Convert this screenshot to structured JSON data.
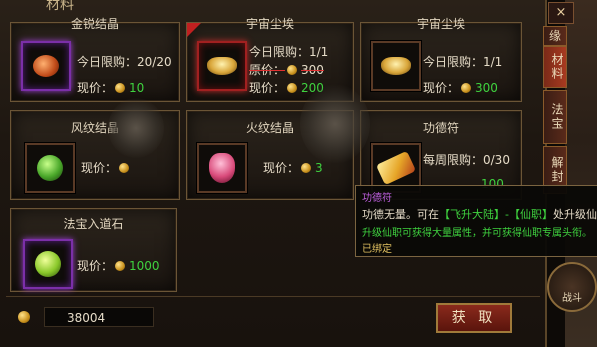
{
  "panel": {
    "title": "材料"
  },
  "cards": [
    {
      "title": "金锐结晶",
      "limit_label": "今日限购：20/20",
      "price_label": "现价：",
      "price": "10"
    },
    {
      "title": "宇宙尘埃",
      "limit_label": "今日限购：1/1",
      "orig_label": "原价：",
      "orig_price": "300",
      "price_label": "现价：",
      "price": "200"
    },
    {
      "title": "宇宙尘埃",
      "limit_label": "今日限购：1/1",
      "price_label": "现价：",
      "price": "300"
    },
    {
      "title": "风纹结晶",
      "price_label": "现价："
    },
    {
      "title": "火纹结晶",
      "price_label": "现价：",
      "price": "3"
    },
    {
      "title": "功德符",
      "limit_label": "每周限购：0/30",
      "price": "100"
    },
    {
      "title": "法宝入道石",
      "price_label": "现价：",
      "price": "1000"
    }
  ],
  "tooltip": {
    "name": "功德符",
    "line1_a": "功德无量。可在",
    "line1_b": "【飞升大陆】-【仙职】",
    "line1_c": "处升级仙职。",
    "line2": "升级仙职可获得大量属性，并可获得仙职专属头衔。",
    "line3": "已绑定"
  },
  "side_tabs": [
    "缘",
    "材料",
    "法宝",
    "解封"
  ],
  "bottom": {
    "gold": "38004",
    "buy_label": "获 取"
  },
  "close_icon": "×",
  "battle_label": "战斗",
  "colors": {
    "green": "#3fd23f",
    "purple": "#c060e0",
    "red": "#e03030",
    "gold": "#ffd24a"
  }
}
